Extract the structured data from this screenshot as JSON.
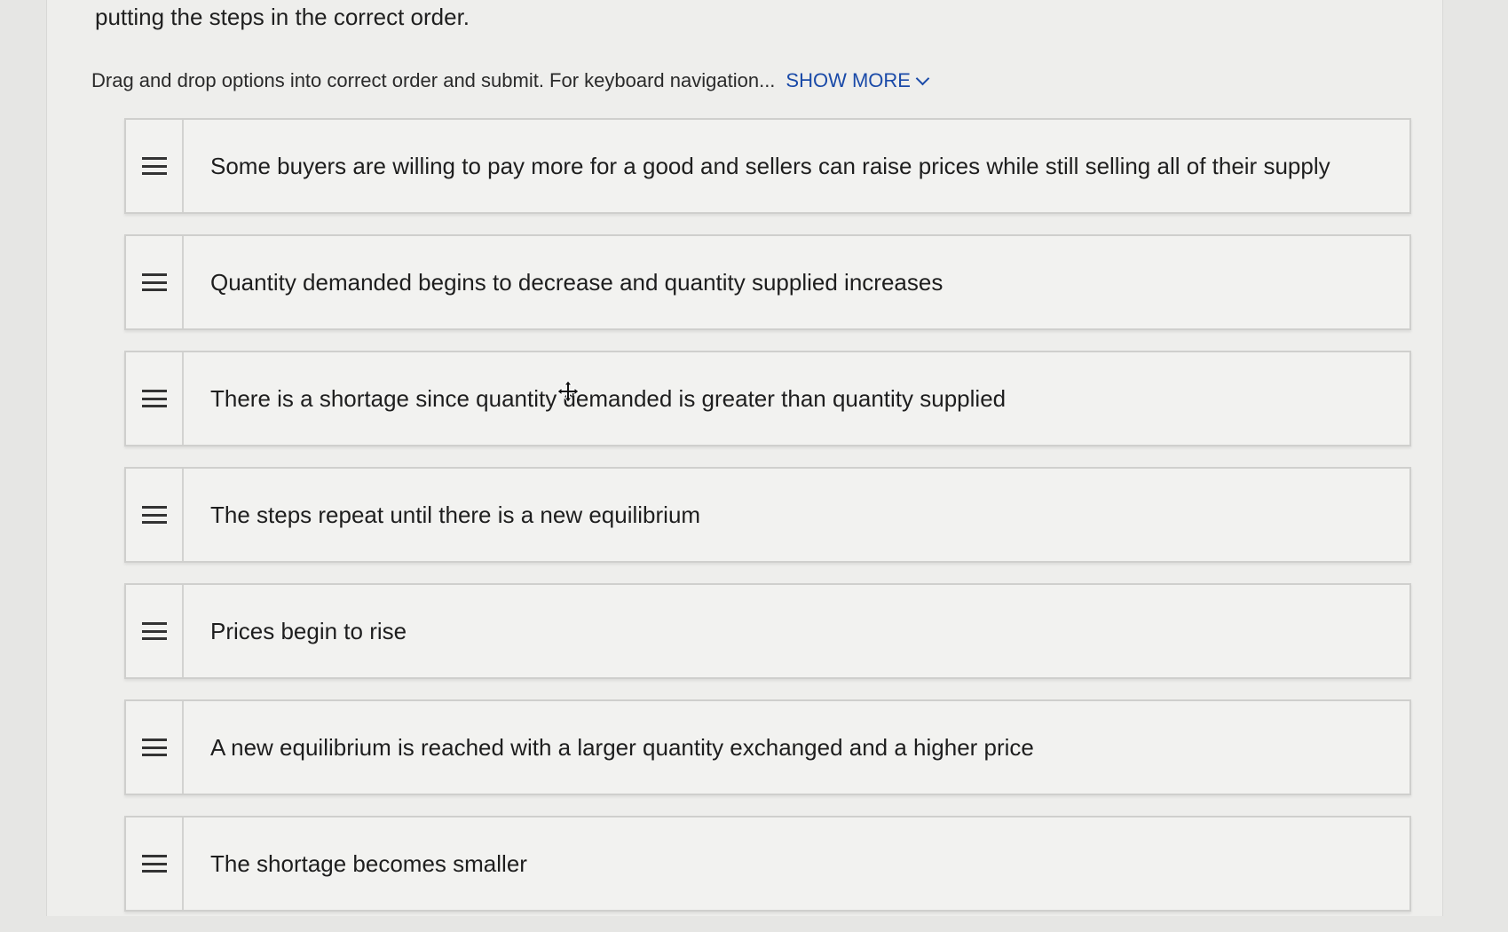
{
  "question": {
    "instruction_tail": "putting the steps in the correct order.",
    "helper_text": "Drag and drop options into correct order and submit. For keyboard navigation...",
    "show_more_label": "SHOW MORE"
  },
  "steps": [
    {
      "text": "Some buyers are willing to pay more for a good and sellers can raise prices while still selling all of their supply"
    },
    {
      "text": "Quantity demanded begins to decrease and quantity supplied increases"
    },
    {
      "text": "There is a shortage since quantity demanded is greater than quantity supplied"
    },
    {
      "text": "The steps repeat until there is a new equilibrium"
    },
    {
      "text": "Prices begin to rise"
    },
    {
      "text": "A new equilibrium is reached with a larger quantity exchanged and a higher price"
    },
    {
      "text": "The shortage becomes smaller"
    }
  ],
  "icons": {
    "drag_handle": "drag-handle-icon",
    "show_more": "chevron-down-icon",
    "cursor": "move-cursor-icon"
  },
  "colors": {
    "link": "#1a4aa8",
    "panel_background": "#eeeeec",
    "item_background": "#f2f2f0",
    "item_border": "#cfcfcd"
  }
}
